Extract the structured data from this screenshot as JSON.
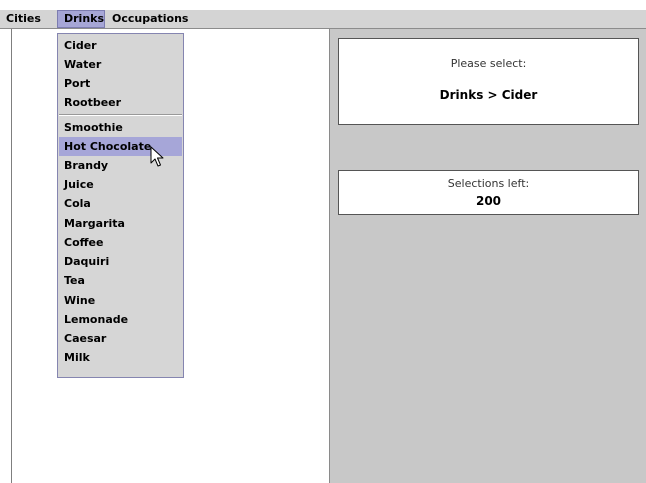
{
  "menubar": {
    "menus": [
      "Cities",
      "Drinks",
      "Occupations"
    ]
  },
  "drinks_menu": {
    "items": [
      "Cider",
      "Water",
      "Port",
      "Rootbeer",
      "Smoothie",
      "Hot Chocolate",
      "Brandy",
      "Juice",
      "Cola",
      "Margarita",
      "Coffee",
      "Daquiri",
      "Tea",
      "Wine",
      "Lemonade",
      "Caesar",
      "Milk"
    ],
    "highlighted": "Hot Chocolate"
  },
  "selection_card": {
    "caption": "Please select:",
    "value": "Drinks > Cider"
  },
  "remaining_card": {
    "caption": "Selections left:",
    "value": "200"
  },
  "icons": {
    "cursor": "arrow-pointer-icon"
  },
  "colors": {
    "highlight": "#a6a6d8",
    "menubar": "#d4d4d4",
    "panel": "#c8c8c8"
  }
}
